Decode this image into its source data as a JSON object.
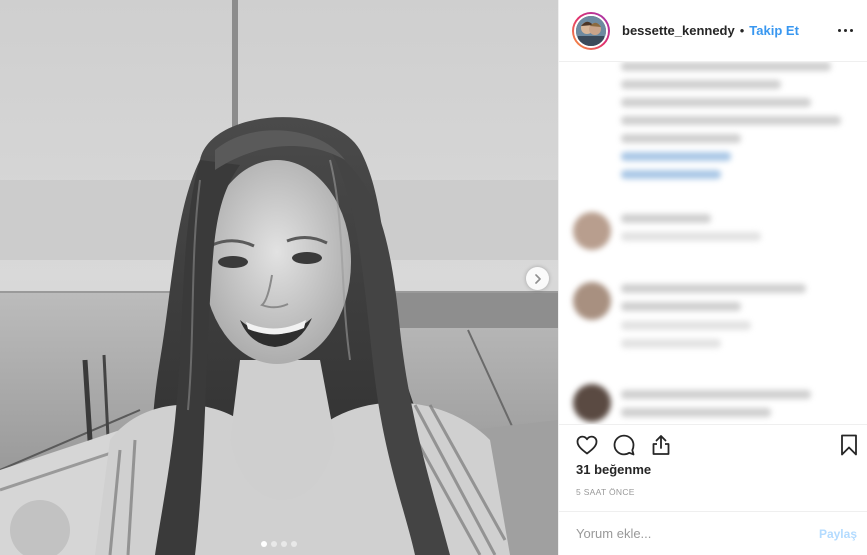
{
  "post": {
    "username": "bessette_kennedy",
    "separator": "•",
    "follow_label": "Takip Et",
    "likes_text": "31 beğenme",
    "time_text": "5 SAAT ÖNCE",
    "comment_placeholder": "Yorum ekle...",
    "share_label": "Paylaş",
    "carousel": {
      "slide_count": 4,
      "active_index": 0
    }
  },
  "icons": {
    "like": "heart-icon",
    "comment": "comment-icon",
    "share": "share-icon",
    "save": "bookmark-icon",
    "more": "more-options-icon",
    "next": "chevron-right-icon"
  },
  "colors": {
    "accent": "#3897f0",
    "text": "#262626",
    "muted": "#999999",
    "divider": "#efefef"
  }
}
